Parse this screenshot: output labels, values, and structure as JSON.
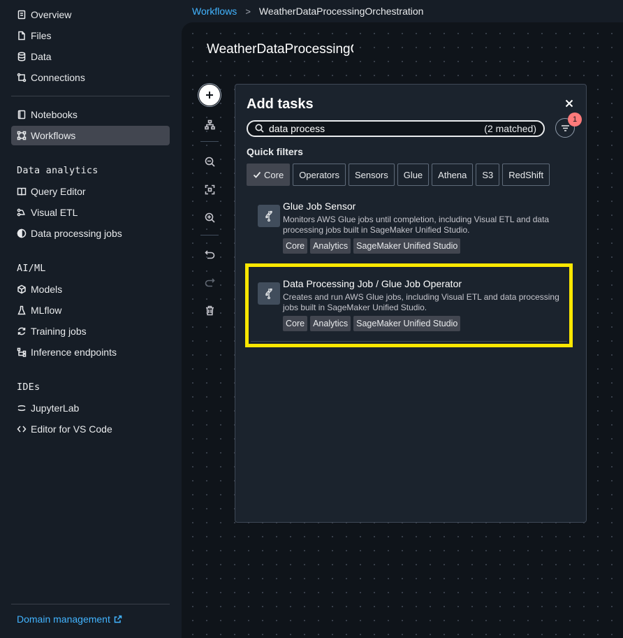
{
  "sidebar": {
    "top_items": [
      {
        "label": "Overview",
        "icon": "document-icon"
      },
      {
        "label": "Files",
        "icon": "file-icon"
      },
      {
        "label": "Data",
        "icon": "database-icon"
      },
      {
        "label": "Connections",
        "icon": "connections-icon"
      }
    ],
    "workspace_items": [
      {
        "label": "Notebooks",
        "icon": "notebook-icon"
      },
      {
        "label": "Workflows",
        "icon": "workflow-icon",
        "active": true
      }
    ],
    "sections": [
      {
        "title": "Data analytics",
        "items": [
          {
            "label": "Query Editor",
            "icon": "book-icon"
          },
          {
            "label": "Visual ETL",
            "icon": "etl-icon"
          },
          {
            "label": "Data processing jobs",
            "icon": "half-circle-icon"
          }
        ]
      },
      {
        "title": "AI/ML",
        "items": [
          {
            "label": "Models",
            "icon": "cube-icon"
          },
          {
            "label": "MLflow",
            "icon": "flask-icon"
          },
          {
            "label": "Training jobs",
            "icon": "refresh-icon"
          },
          {
            "label": "Inference endpoints",
            "icon": "endpoints-icon"
          }
        ]
      },
      {
        "title": "IDEs",
        "items": [
          {
            "label": "JupyterLab",
            "icon": "jupyter-icon"
          },
          {
            "label": "Editor for VS Code",
            "icon": "code-icon"
          }
        ]
      }
    ],
    "domain_management": "Domain management"
  },
  "breadcrumb": {
    "parent": "Workflows",
    "separator": ">",
    "current": "WeatherDataProcessingOrchestration"
  },
  "canvas": {
    "title": "WeatherDataProcessingOrchestration"
  },
  "panel": {
    "title": "Add tasks",
    "search": {
      "value": "data process",
      "matched": "(2 matched)"
    },
    "filter_badge": "1",
    "quick_filters_label": "Quick filters",
    "chips": [
      {
        "label": "Core",
        "selected": true
      },
      {
        "label": "Operators",
        "selected": false
      },
      {
        "label": "Sensors",
        "selected": false
      },
      {
        "label": "Glue",
        "selected": false
      },
      {
        "label": "Athena",
        "selected": false
      },
      {
        "label": "S3",
        "selected": false
      },
      {
        "label": "RedShift",
        "selected": false
      }
    ],
    "results": [
      {
        "title": "Glue Job Sensor",
        "description": "Monitors AWS Glue jobs until completion, including Visual ETL and data processing jobs built in SageMaker Unified Studio.",
        "tags": [
          "Core",
          "Analytics",
          "SageMaker Unified Studio"
        ]
      },
      {
        "title": "Data Processing Job / Glue Job Operator",
        "description": "Creates and run AWS Glue jobs, including Visual ETL and data processing jobs built in SageMaker Unified Studio.",
        "tags": [
          "Core",
          "Analytics",
          "SageMaker Unified Studio"
        ]
      }
    ]
  },
  "colors": {
    "highlight": "#fce700",
    "link": "#42b4ff",
    "badge": "#ff7a7a"
  }
}
